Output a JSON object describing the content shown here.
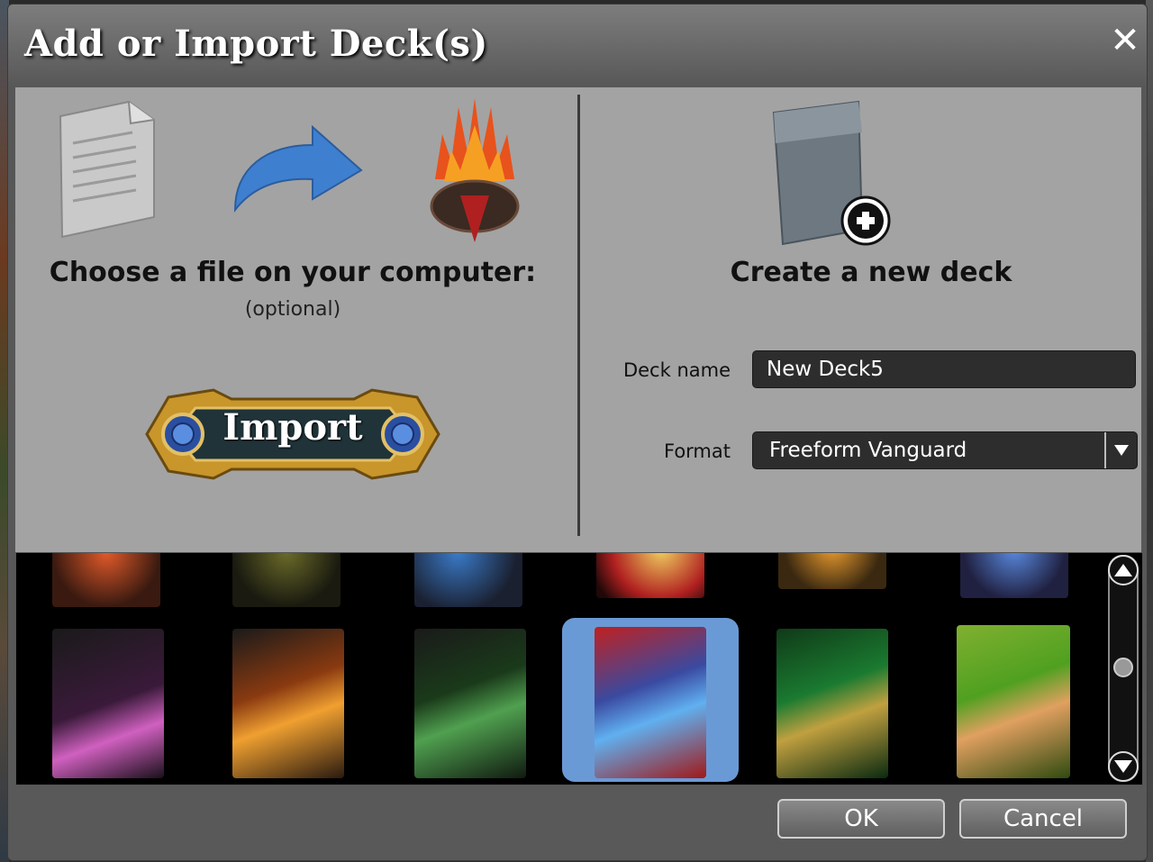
{
  "dialog": {
    "title": "Add or Import Deck(s)",
    "close_symbol": "✕"
  },
  "import_section": {
    "title": "Choose a file on your computer:",
    "subtitle": "(optional)",
    "import_label": "Import",
    "icons": [
      "document-icon",
      "arrow-icon",
      "mtg-arena-logo-icon"
    ]
  },
  "create_section": {
    "title": "Create a new deck",
    "deck_name_label": "Deck name",
    "deck_name_value": "New Deck5",
    "format_label": "Format",
    "format_value": "Freeform Vanguard",
    "icon": "deck-box-plus-icon"
  },
  "gallery": {
    "selected_index": 3
  },
  "footer": {
    "ok_label": "OK",
    "cancel_label": "Cancel"
  },
  "colors": {
    "accent_selected": "#6a9ad6",
    "panel_bg": "#a3a3a3",
    "input_bg": "#2d2d2d"
  }
}
